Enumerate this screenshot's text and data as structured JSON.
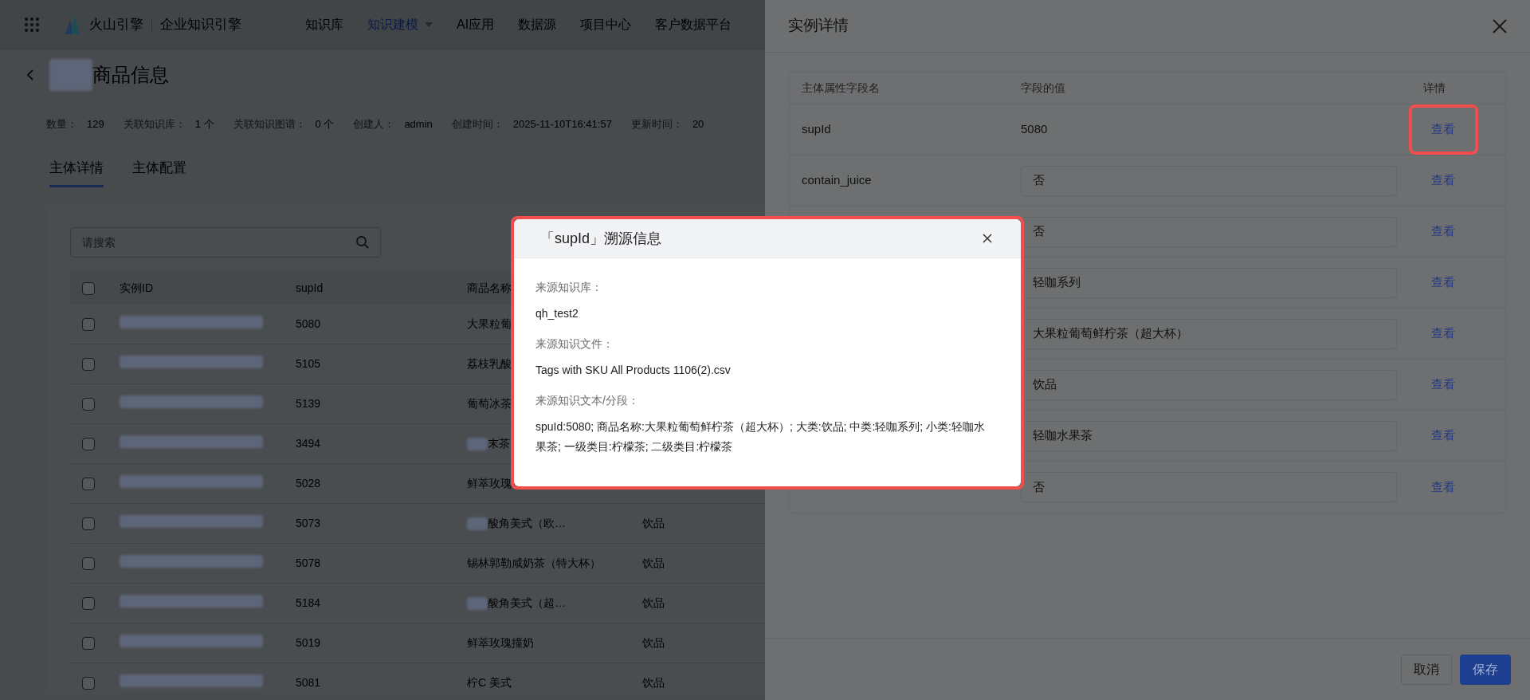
{
  "header": {
    "brand": "火山引擎",
    "product": "企业知识引擎",
    "nav": [
      {
        "label": "知识库",
        "selected": false,
        "dropdown": false
      },
      {
        "label": "知识建模",
        "selected": true,
        "dropdown": true
      },
      {
        "label": "AI应用",
        "selected": false,
        "dropdown": false
      },
      {
        "label": "数据源",
        "selected": false,
        "dropdown": false
      },
      {
        "label": "项目中心",
        "selected": false,
        "dropdown": false
      },
      {
        "label": "客户数据平台",
        "selected": false,
        "dropdown": false
      }
    ]
  },
  "page": {
    "title": "商品信息",
    "title_prefix_redacted": true,
    "meta": [
      {
        "label": "数量：",
        "value": "129"
      },
      {
        "label": "关联知识库：",
        "value": "1 个"
      },
      {
        "label": "关联知识图谱：",
        "value": "0 个"
      },
      {
        "label": "创建人：",
        "value": "admin"
      },
      {
        "label": "创建时间：",
        "value": "2025-11-10T16:41:57"
      },
      {
        "label": "更新时间：",
        "value": "20"
      }
    ],
    "tabs": [
      {
        "label": "主体详情",
        "selected": true
      },
      {
        "label": "主体配置",
        "selected": false
      }
    ]
  },
  "search": {
    "placeholder": "请搜索"
  },
  "table": {
    "all_checked": false,
    "columns": [
      "实例ID",
      "supId",
      "商品名称"
    ],
    "rows": [
      {
        "checked": false,
        "id_redacted": true,
        "supid": "5080",
        "product": "大果粒葡",
        "product_prefix_redacted": false
      },
      {
        "checked": false,
        "id_redacted": true,
        "supid": "5105",
        "product": "荔枝乳酸",
        "product_prefix_redacted": false
      },
      {
        "checked": false,
        "id_redacted": true,
        "supid": "5139",
        "product": "葡萄冰茶",
        "product_prefix_redacted": false
      },
      {
        "checked": false,
        "id_redacted": true,
        "supid": "3494",
        "product": "末茶",
        "product_prefix_redacted": true
      },
      {
        "checked": false,
        "id_redacted": true,
        "supid": "5028",
        "product": "鲜萃玫瑰",
        "product_prefix_redacted": false
      },
      {
        "checked": false,
        "id_redacted": true,
        "supid": "5073",
        "product": "酸角美式（欧…",
        "product_prefix_redacted": true,
        "category": "饮品"
      },
      {
        "checked": false,
        "id_redacted": true,
        "supid": "5078",
        "product": "锡林郭勒咸奶茶（特大杯）",
        "product_prefix_redacted": false,
        "category": "饮品"
      },
      {
        "checked": false,
        "id_redacted": true,
        "supid": "5184",
        "product": "酸角美式（超…",
        "product_prefix_redacted": true,
        "category": "饮品"
      },
      {
        "checked": false,
        "id_redacted": true,
        "supid": "5019",
        "product": "鲜萃玫瑰撞奶",
        "product_prefix_redacted": false,
        "category": "饮品"
      },
      {
        "checked": false,
        "id_redacted": true,
        "supid": "5081",
        "product": "柠C 美式",
        "product_prefix_redacted": false,
        "category": "饮品"
      }
    ]
  },
  "drawer": {
    "title": "实例详情",
    "columns": [
      "主体属性字段名",
      "字段的值",
      "详情"
    ],
    "rows": [
      {
        "field": "supId",
        "kind": "text",
        "value": "5080",
        "action": "查看",
        "highlighted": true
      },
      {
        "field": "contain_juice",
        "kind": "input",
        "value": "否",
        "action": "查看",
        "highlighted": false
      },
      {
        "kind": "input",
        "value": "否",
        "action": "查看",
        "highlighted": false
      },
      {
        "kind": "input",
        "value": "轻咖系列",
        "action": "查看",
        "highlighted": false
      },
      {
        "kind": "input",
        "value": "大果粒葡萄鲜柠茶（超大杯）",
        "action": "查看",
        "highlighted": false
      },
      {
        "kind": "input",
        "value": "饮品",
        "action": "查看",
        "highlighted": false
      },
      {
        "kind": "input",
        "value": "轻咖水果茶",
        "action": "查看",
        "highlighted": false
      },
      {
        "kind": "input",
        "value": "否",
        "action": "查看",
        "highlighted": false
      }
    ],
    "buttons": [
      {
        "label": "取消",
        "kind": "secondary"
      },
      {
        "label": "保存",
        "kind": "primary"
      }
    ]
  },
  "modal": {
    "title": "「supId」溯源信息",
    "highlighted": true,
    "sections": [
      {
        "label": "来源知识库：",
        "value": "qh_test2"
      },
      {
        "label": "来源知识文件：",
        "value": "Tags with SKU All Products 1106(2).csv"
      },
      {
        "label": "来源知识文本/分段：",
        "value": "spuId:5080; 商品名称:大果粒葡萄鲜柠茶（超大杯）; 大类:饮品; 中类:轻咖系列; 小类:轻咖水果茶; 一级类目:柠檬茶; 二级类目:柠檬茶"
      }
    ]
  }
}
